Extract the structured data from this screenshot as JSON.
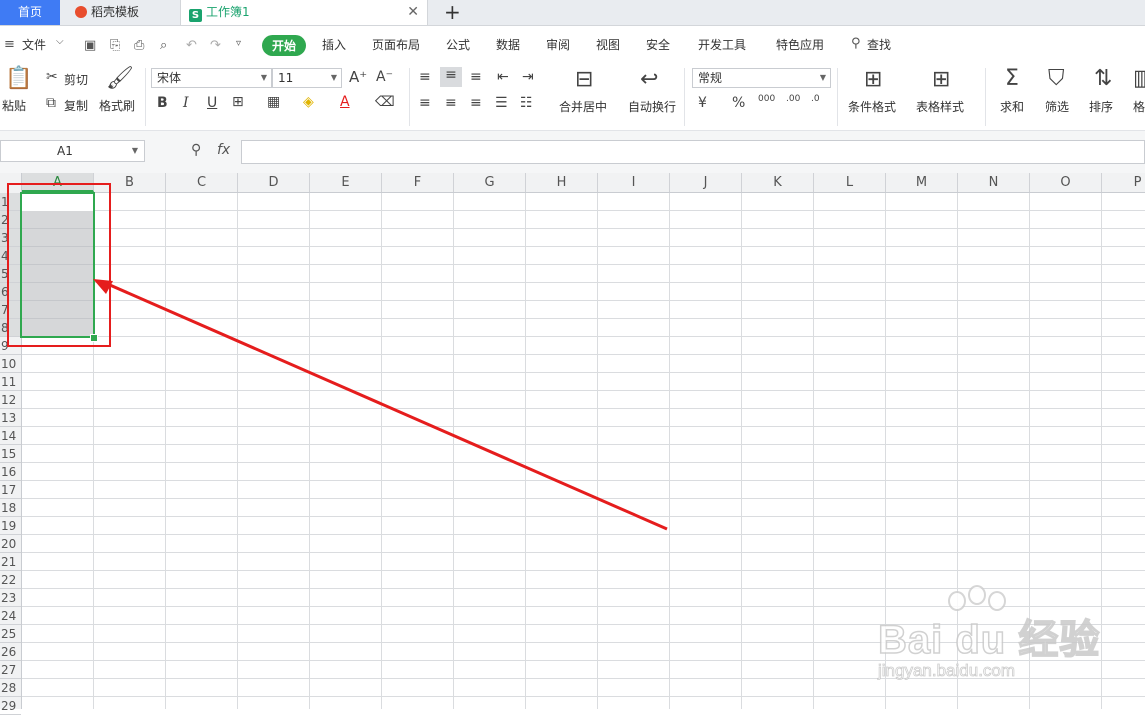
{
  "tabs": {
    "home": "首页",
    "template": "稻壳模板",
    "workbook": "工作簿1",
    "workbook_logo": "S"
  },
  "menu": {
    "file": "文件",
    "items": [
      "开始",
      "插入",
      "页面布局",
      "公式",
      "数据",
      "审阅",
      "视图",
      "安全",
      "开发工具",
      "特色应用"
    ],
    "search": "查找"
  },
  "ribbon": {
    "paste": "粘贴",
    "cut": "剪切",
    "copy": "复制",
    "format_painter": "格式刷",
    "font_name": "宋体",
    "font_size": "11",
    "merge_center": "合并居中",
    "wrap_text": "自动换行",
    "number_format": "常规",
    "conditional_format": "条件格式",
    "table_style": "表格样式",
    "sum": "求和",
    "filter": "筛选",
    "sort": "排序",
    "format_partial": "格"
  },
  "formula_bar": {
    "cell_ref": "A1",
    "fx": "fx",
    "value": ""
  },
  "columns": [
    "A",
    "B",
    "C",
    "D",
    "E",
    "F",
    "G",
    "H",
    "I",
    "J",
    "K",
    "L",
    "M",
    "N",
    "O",
    "P"
  ],
  "rows": [
    "1",
    "2",
    "3",
    "4",
    "5",
    "6",
    "7",
    "8",
    "9",
    "10",
    "11",
    "12",
    "13",
    "14",
    "15",
    "16",
    "17",
    "18",
    "19",
    "20",
    "21",
    "22",
    "23",
    "24",
    "25",
    "26",
    "27",
    "28",
    "29"
  ],
  "selection": {
    "range": "A1:A8",
    "active_cell": "A1"
  },
  "watermark": {
    "brand": "Bai du 经验",
    "url": "jingyan.baidu.com"
  },
  "colors": {
    "accent_green": "#2fa84f",
    "annotation_red": "#e51d1d",
    "tab_blue": "#3f7bf4"
  }
}
